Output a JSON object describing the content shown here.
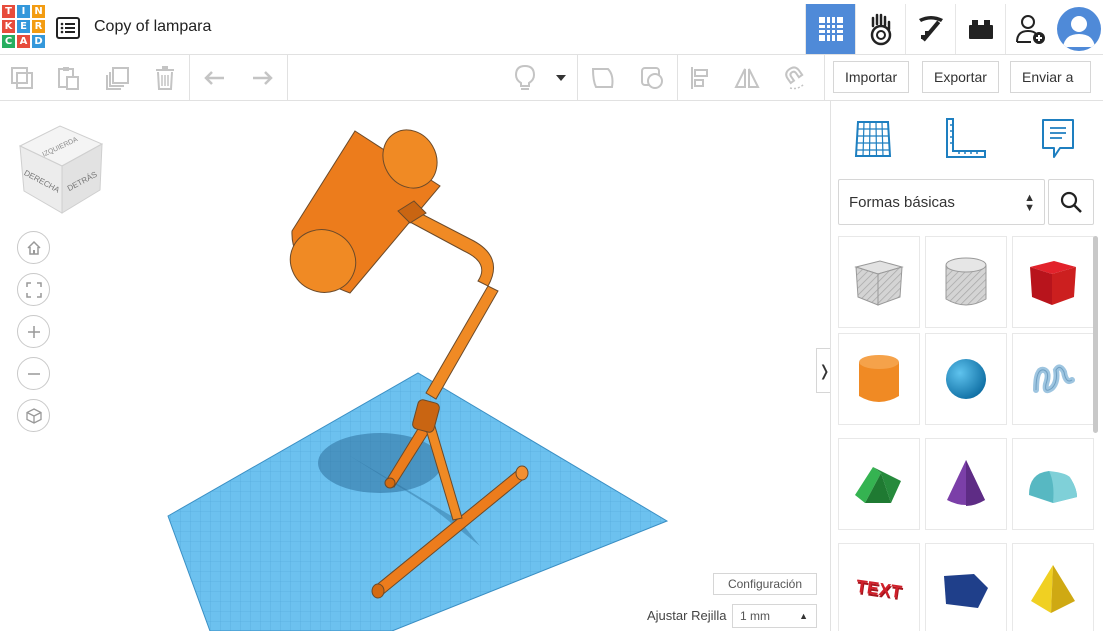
{
  "app": {
    "logo_letters": [
      "T",
      "I",
      "N",
      "K",
      "E",
      "R",
      "C",
      "A",
      "D"
    ],
    "logo_colors": [
      "#e74c3c",
      "#3498db",
      "#f39c12",
      "#e74c3c",
      "#3498db",
      "#f39c12",
      "#27ae60",
      "#e74c3c",
      "#3498db"
    ],
    "project_title": "Copy of lampara",
    "accent": "#4f8ad8"
  },
  "top_nav": [
    {
      "name": "3d-design-view",
      "icon": "grid-icon",
      "active": true
    },
    {
      "name": "circuits-view",
      "icon": "hand-icon",
      "active": false
    },
    {
      "name": "minecraft-view",
      "icon": "pickaxe-icon",
      "active": false
    },
    {
      "name": "bricks-view",
      "icon": "brick-icon",
      "active": false
    },
    {
      "name": "invite-user",
      "icon": "add-user-icon",
      "active": false
    }
  ],
  "toolbar": {
    "import_label": "Importar",
    "export_label": "Exportar",
    "send_label": "Enviar a"
  },
  "view_cube": {
    "top_label": "IZQUIERDA",
    "left_label": "DERECHA",
    "right_label": "DETRÁS"
  },
  "panel": {
    "tabs": [
      {
        "name": "workplane",
        "icon": "workplane-grid-icon"
      },
      {
        "name": "ruler",
        "icon": "ruler-icon"
      },
      {
        "name": "notes",
        "icon": "notes-icon"
      }
    ],
    "shape_category": "Formas básicas",
    "shapes": [
      {
        "name": "box-hole",
        "icon": "box-hole-icon"
      },
      {
        "name": "cylinder-hole",
        "icon": "cylinder-hole-icon"
      },
      {
        "name": "box",
        "icon": "box-icon",
        "color": "#cc1f1f"
      },
      {
        "name": "cylinder",
        "icon": "cylinder-icon",
        "color": "#f08a24"
      },
      {
        "name": "sphere",
        "icon": "sphere-icon",
        "color": "#1e90c8"
      },
      {
        "name": "scribble",
        "icon": "scribble-icon",
        "color": "#9ec5e0"
      },
      {
        "name": "roof",
        "icon": "roof-icon",
        "color": "#2ea34a"
      },
      {
        "name": "cone",
        "icon": "cone-icon",
        "color": "#7b3fa8"
      },
      {
        "name": "round-roof",
        "icon": "round-roof-icon",
        "color": "#57b8c2"
      },
      {
        "name": "text",
        "icon": "text-icon",
        "color": "#d0202a",
        "label": "TEXT"
      },
      {
        "name": "polygon",
        "icon": "polygon-icon",
        "color": "#1f3f8a"
      },
      {
        "name": "pyramid",
        "icon": "pyramid-icon",
        "color": "#e8c21a"
      }
    ]
  },
  "viewport": {
    "config_label": "Configuración",
    "grid_snap_label": "Ajustar Rejilla",
    "grid_snap_value": "1 mm",
    "model_color": "#f08a24",
    "workplane_color": "#5eb7e8"
  }
}
